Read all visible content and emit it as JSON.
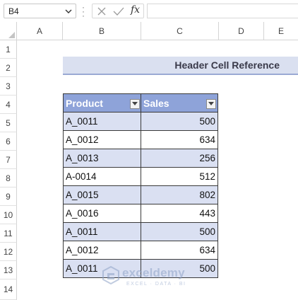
{
  "formula_bar": {
    "name_box": "B4",
    "fx_label": "fx",
    "formula": ""
  },
  "columns": [
    "A",
    "B",
    "C",
    "D",
    "E"
  ],
  "rows": [
    "1",
    "2",
    "3",
    "4",
    "5",
    "6",
    "7",
    "8",
    "9",
    "10",
    "11",
    "12",
    "13",
    "14"
  ],
  "title": "Header Cell Reference",
  "table": {
    "headers": [
      "Product",
      "Sales"
    ],
    "rows": [
      {
        "product": "A_0011",
        "sales": "500"
      },
      {
        "product": "A_0012",
        "sales": "634"
      },
      {
        "product": "A_0013",
        "sales": "256"
      },
      {
        "product": "A-0014",
        "sales": "512"
      },
      {
        "product": "A_0015",
        "sales": "802"
      },
      {
        "product": "A_0016",
        "sales": "443"
      },
      {
        "product": "A_0011",
        "sales": "500"
      },
      {
        "product": "A_0012",
        "sales": "634"
      },
      {
        "product": "A_0011",
        "sales": "500"
      }
    ]
  },
  "watermark": {
    "name": "exceldemy",
    "tagline": "EXCEL · DATA · BI"
  },
  "colors": {
    "header_fill": "#8ea3d9",
    "band_fill": "#dae0f2",
    "title_fill": "#dae0f0"
  }
}
